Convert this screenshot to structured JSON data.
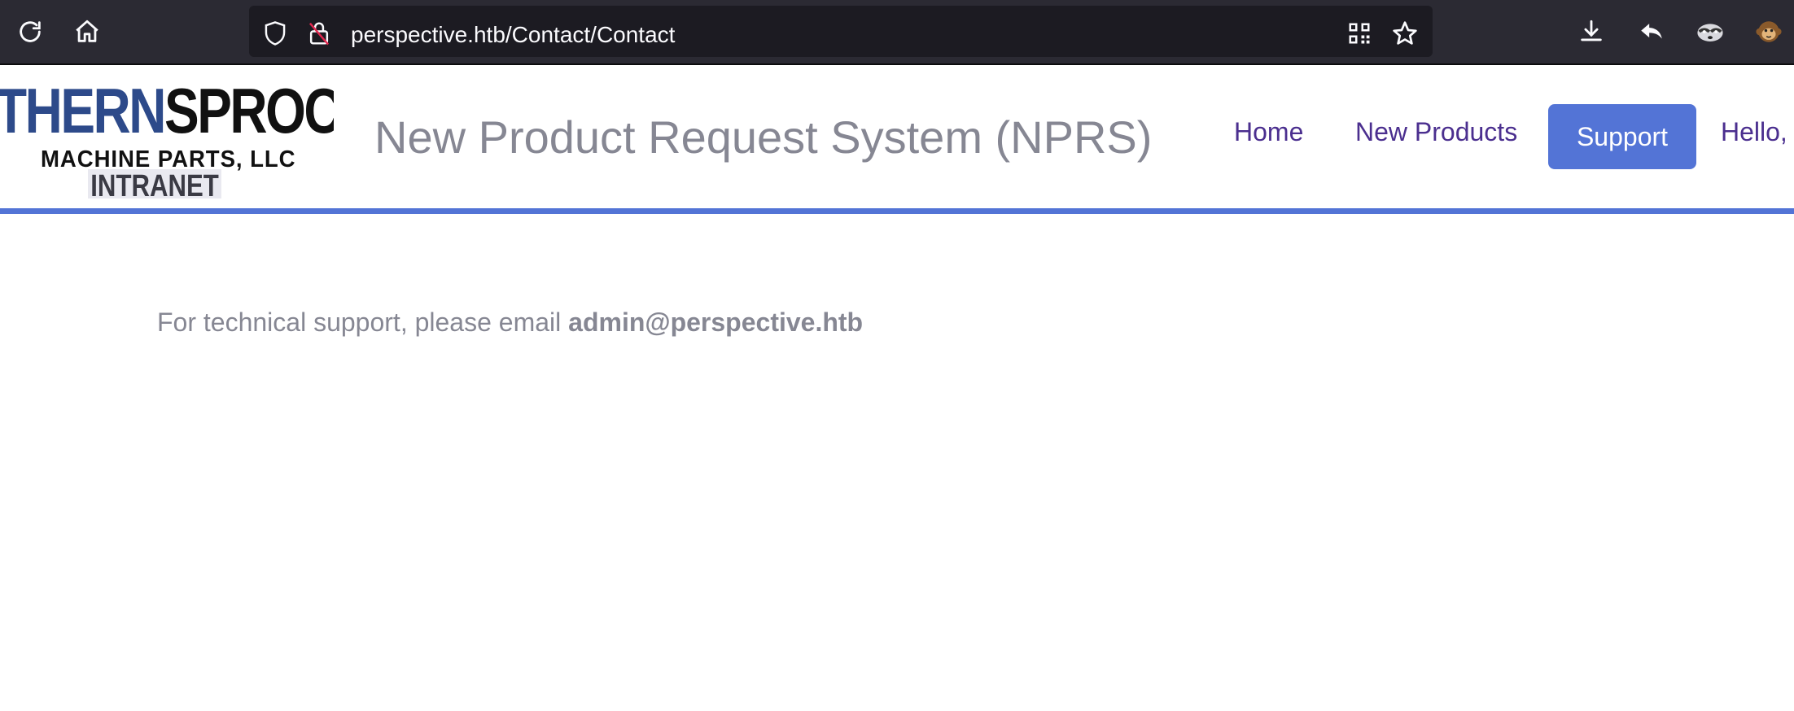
{
  "browser": {
    "url": "perspective.htb/Contact/Contact",
    "icons": {
      "reload": "reload-icon",
      "home": "home-icon",
      "shield": "shield-icon",
      "insecure_lock": "insecure-lock-icon",
      "qr": "qr-code-icon",
      "bookmark": "star-icon",
      "downloads": "download-icon",
      "back": "reply-arrow-icon",
      "extension1": "raccoon-extension-icon",
      "extension2": "monkey-extension-icon"
    }
  },
  "site": {
    "logo": {
      "line1_blue": "THERN",
      "line1_black": "SPROCKET",
      "line2": "MACHINE PARTS, LLC",
      "line3": "INTRANET"
    },
    "title": "New Product Request System (NPRS)",
    "nav": {
      "home": "Home",
      "new_products": "New Products",
      "support": "Support",
      "hello": "Hello,"
    },
    "accent_color": "#5374d6",
    "link_color": "#4b2f8f"
  },
  "content": {
    "support_text": "For technical support, please email ",
    "support_email": "admin@perspective.htb"
  }
}
